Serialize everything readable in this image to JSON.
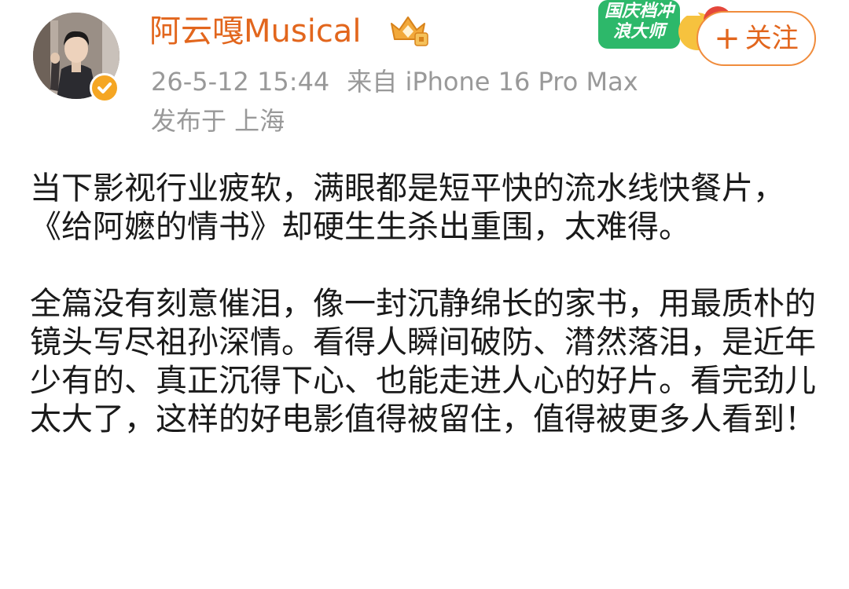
{
  "post": {
    "author": {
      "name": "阿云嘎Musical",
      "verified": true,
      "avatar": "user-avatar",
      "vip_badge": "diamond-crown-icon"
    },
    "timestamp": "26-5-12 15:44",
    "source": "来自 iPhone 16 Pro Max",
    "location": "发布于 上海",
    "promo_banner": {
      "text": "国庆档冲浪大师",
      "icon": "holiday-promo-icon"
    },
    "follow_button": {
      "icon": "plus-icon",
      "label": "关注"
    },
    "paragraphs": [
      "当下影视行业疲软，满眼都是短平快的流水线快餐片，《给阿嬷的情书》却硬生生杀出重围，太难得。",
      "全篇没有刻意催泪，像一封沉静绵长的家书，用最质朴的镜头写尽祖孙深情。看得人瞬间破防、潸然落泪，是近年少有的、真正沉得下心、也能走进人心的好片。看完劲儿太大了，这样的好电影值得被留住，值得被更多人看到！"
    ]
  },
  "colors": {
    "username": "#e2661d",
    "meta_text": "#999999",
    "follow_border": "#f08c3c",
    "verified_badge": "#f5a623",
    "body_text": "#1a1a1a"
  }
}
